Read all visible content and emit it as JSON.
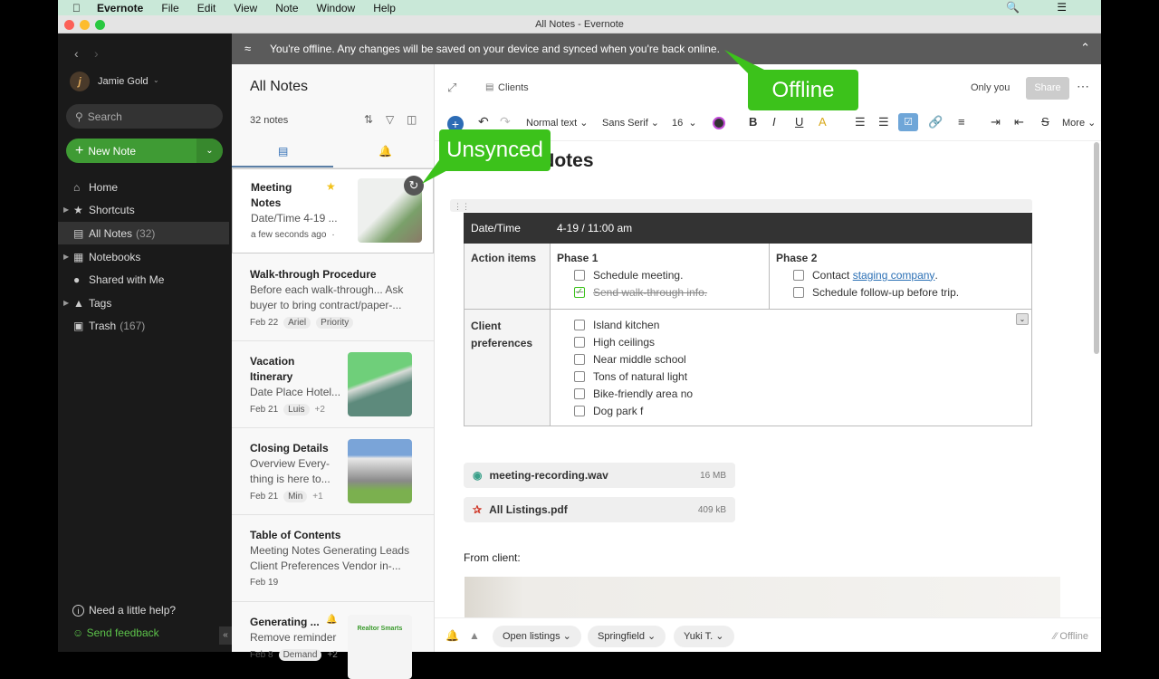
{
  "menubar": {
    "app": "Evernote",
    "items": [
      "File",
      "Edit",
      "View",
      "Note",
      "Window",
      "Help"
    ]
  },
  "window_title": "All Notes - Evernote",
  "sidebar": {
    "user": "Jamie Gold",
    "search_placeholder": "Search",
    "new_note": "New Note",
    "items": [
      {
        "label": "Home",
        "icon": "home-icon"
      },
      {
        "label": "Shortcuts",
        "icon": "star-icon"
      },
      {
        "label": "All Notes",
        "count": "(32)",
        "icon": "note-icon"
      },
      {
        "label": "Notebooks",
        "icon": "notebook-icon"
      },
      {
        "label": "Shared with Me",
        "icon": "people-icon"
      },
      {
        "label": "Tags",
        "icon": "tag-icon"
      },
      {
        "label": "Trash",
        "count": "(167)",
        "icon": "trash-icon"
      }
    ],
    "help": "Need a little help?",
    "feedback": "Send feedback"
  },
  "banner": {
    "text": "You're offline.  Any changes will be saved on your device and synced when you're back online."
  },
  "note_list": {
    "title": "All Notes",
    "count": "32 notes",
    "notes": [
      {
        "title": "Meeting Notes",
        "snippet": "Date/Time 4-19 ...",
        "date": "a few seconds ago",
        "starred": true,
        "unsynced": true
      },
      {
        "title": "Walk-through Procedure",
        "snippet": "Before each walk-through... Ask buyer to bring contract/paper-...",
        "date": "Feb 22",
        "tags": [
          "Ariel",
          "Priority"
        ]
      },
      {
        "title": "Vacation Itinerary",
        "snippet": "Date Place Hotel...",
        "date": "Feb 21",
        "tags": [
          "Luis"
        ],
        "more": "+2"
      },
      {
        "title": "Closing Details",
        "snippet": "Overview Every-thing is here to...",
        "date": "Feb 21",
        "tags": [
          "Min"
        ],
        "more": "+1"
      },
      {
        "title": "Table of Contents",
        "snippet": "Meeting Notes Generating Leads Client Preferences Vendor in-...",
        "date": "Feb 19"
      },
      {
        "title": "Generating ...",
        "snippet": "Remove reminder",
        "date": "Feb 8",
        "tags": [
          "Demand"
        ],
        "more": "+2",
        "thumb_text": "Realtor Smarts"
      }
    ]
  },
  "editor": {
    "notebook": "Clients",
    "sharing": "Only you",
    "share": "Share",
    "toolbar": {
      "style": "Normal text",
      "font": "Sans Serif",
      "size": "16",
      "more": "More"
    },
    "title": "Meeting Notes",
    "table": {
      "date_label": "Date/Time",
      "date_value": "4-19 / 11:00 am",
      "action_label": "Action items",
      "phase1": {
        "title": "Phase 1",
        "items": [
          {
            "text": "Schedule meeting.",
            "done": false
          },
          {
            "text": "Send walk-through info.",
            "done": true
          }
        ]
      },
      "phase2": {
        "title": "Phase 2",
        "items": [
          {
            "text": "Contact ",
            "link": "staging company",
            "after": ".",
            "done": false
          },
          {
            "text": "Schedule follow-up before trip.",
            "done": false
          }
        ]
      },
      "pref_label": "Client preferences",
      "prefs": [
        "Island kitchen",
        "High ceilings",
        "Near middle school",
        "Tons of natural light",
        "Bike-friendly area no",
        "Dog park f"
      ]
    },
    "attachments": [
      {
        "name": "meeting-recording.wav",
        "size": "16 MB"
      },
      {
        "name": "All Listings.pdf",
        "size": "409 kB"
      }
    ],
    "from_client": "From client:",
    "tags": [
      "Open listings",
      "Springfield",
      "Yuki T."
    ],
    "status": "Offline"
  },
  "callouts": {
    "offline": "Offline",
    "unsynced": "Unsynced"
  },
  "colors": {
    "accent_green": "#3cc21b",
    "new_note_green": "#3f9b34",
    "sidebar_bg": "#1a1a1a",
    "link_blue": "#2a6fb5"
  }
}
